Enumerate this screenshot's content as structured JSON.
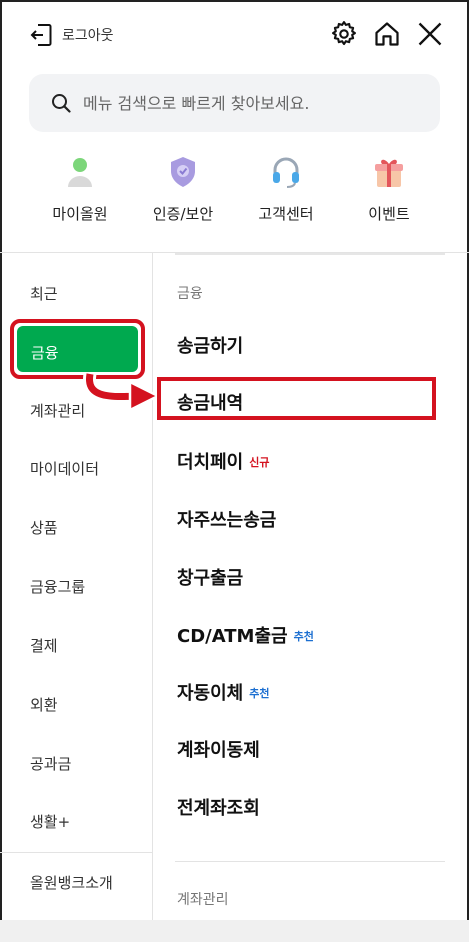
{
  "header": {
    "logout_label": "로그아웃",
    "icons": [
      "logout-icon",
      "gear-icon",
      "home-icon",
      "close-icon"
    ]
  },
  "search": {
    "placeholder": "메뉴 검색으로 빠르게 찾아보세요."
  },
  "quick_menu": [
    {
      "label": "마이올원",
      "icon": "person-icon"
    },
    {
      "label": "인증/보안",
      "icon": "shield-icon"
    },
    {
      "label": "고객센터",
      "icon": "headset-icon"
    },
    {
      "label": "이벤트",
      "icon": "gift-icon"
    }
  ],
  "sidebar": {
    "items": [
      {
        "label": "최근"
      },
      {
        "label": "금융",
        "active": true
      },
      {
        "label": "계좌관리"
      },
      {
        "label": "마이데이터"
      },
      {
        "label": "상품"
      },
      {
        "label": "금융그룹"
      },
      {
        "label": "결제"
      },
      {
        "label": "외환"
      },
      {
        "label": "공과금"
      },
      {
        "label": "생활+"
      }
    ],
    "footer": "올원뱅크소개"
  },
  "content": {
    "section_title": "금융",
    "items": [
      {
        "label": "송금하기"
      },
      {
        "label": "송금내역",
        "highlighted": true
      },
      {
        "label": "더치페이",
        "badge": "신규"
      },
      {
        "label": "자주쓰는송금"
      },
      {
        "label": "창구출금"
      },
      {
        "label": "CD/ATM출금",
        "badge": "추천"
      },
      {
        "label": "자동이체",
        "badge": "추천"
      },
      {
        "label": "계좌이동제"
      },
      {
        "label": "전계좌조회"
      }
    ],
    "next_section_title": "계좌관리"
  },
  "colors": {
    "accent_green": "#00a94f",
    "highlight_red": "#d4121f",
    "badge_blue": "#1c6fd1"
  }
}
